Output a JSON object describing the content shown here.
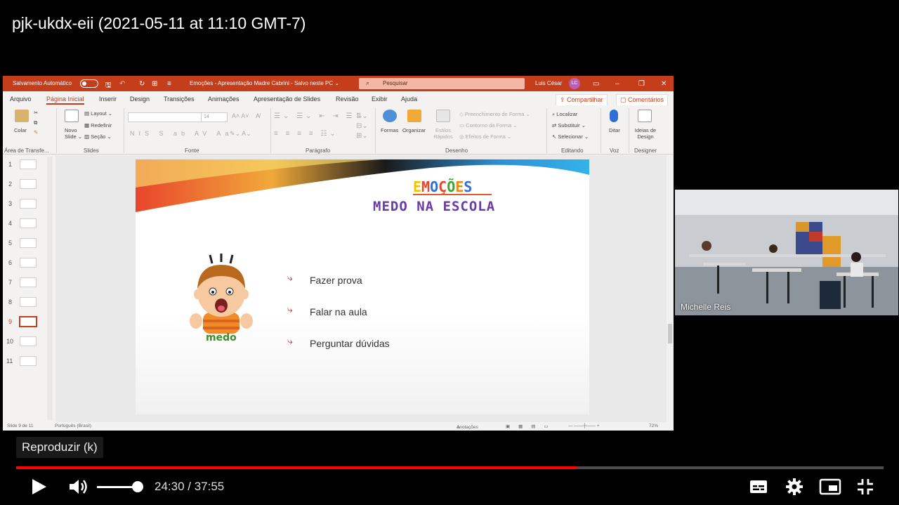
{
  "video": {
    "title": "pjk-ukdx-eii (2021-05-11 at 11:10 GMT-7)"
  },
  "powerpoint": {
    "autosave_label": "Salvamento Automático",
    "doc_title": "Emoções - Apresentação Madre Cabrini  -  Salvo neste PC  ⌄",
    "search_placeholder": "Pesquisar",
    "user_name": "Luis César",
    "user_initials": "LC",
    "menu_tabs": [
      "Arquivo",
      "Página Inicial",
      "Inserir",
      "Design",
      "Transições",
      "Animações",
      "Apresentação de Slides",
      "Revisão",
      "Exibir",
      "Ajuda"
    ],
    "share_label": "Compartilhar",
    "comments_label": "Comentários",
    "ribbon": {
      "paste": "Colar",
      "new_slide": "Novo Slide ⌄",
      "layout": "Layout ⌄",
      "reset": "Redefinir",
      "section": "Seção ⌄",
      "font_size": "14",
      "shapes": "Formas",
      "arrange": "Organizar",
      "quick_styles": "Estilos Rápidos",
      "shape_fill": "Preenchimento de Forma ⌄",
      "shape_outline": "Contorno da Forma ⌄",
      "shape_effects": "Efeitos de Forma ⌄",
      "find": "Localizar",
      "replace": "Substituir ⌄",
      "select": "Selecionar ⌄",
      "dictate": "Ditar",
      "design_ideas": "Ideias de Design",
      "groups": {
        "clipboard": "Área de Transfe...",
        "slides": "Slides",
        "font": "Fonte",
        "paragraph": "Parágrafo",
        "drawing": "Desenho",
        "editing": "Editando",
        "voice": "Voz",
        "designer": "Designer"
      }
    },
    "thumbnails": [
      "1",
      "2",
      "3",
      "4",
      "5",
      "6",
      "7",
      "8",
      "9",
      "10",
      "11"
    ],
    "selected_slide": "9",
    "slide": {
      "title": "EMOÇÕES",
      "title_letter_colors": [
        "#f2c200",
        "#e8452c",
        "#2f6fd6",
        "#e8452c",
        "#3aa63a",
        "#e88a1a",
        "#2f6fd6"
      ],
      "subtitle": "MEDO NA ESCOLA",
      "bullets": [
        "Fazer prova",
        "Falar na aula",
        "Perguntar dúvidas"
      ],
      "image_caption": "medo"
    },
    "status": {
      "slide_count": "Slide 9 de 11",
      "language": "Português (Brasil)",
      "notes": "Anotações",
      "zoom": "72%"
    }
  },
  "webcam": {
    "name": "Michelle Reis"
  },
  "player": {
    "tooltip": "Reproduzir (k)",
    "current_time": "24:30",
    "separator": " / ",
    "duration": "37:55",
    "progress_fraction": 0.646,
    "volume_fraction": 0.9,
    "accent_color": "#ff0000"
  }
}
